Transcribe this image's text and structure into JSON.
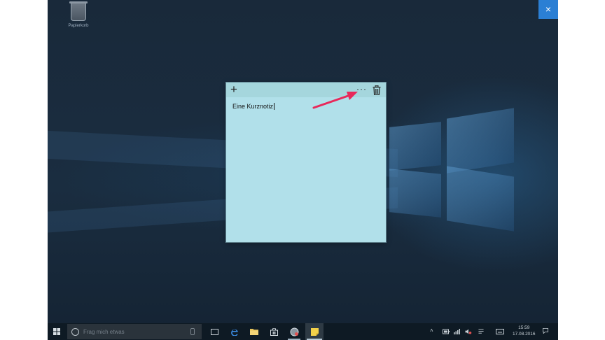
{
  "desktop": {
    "recycle_bin_label": "Papierkorb"
  },
  "overlay": {
    "close_glyph": "×",
    "accent": "#2b7fd4"
  },
  "sticky_note": {
    "add_glyph": "+",
    "menu_glyph": "···",
    "text": "Eine Kurznotiz",
    "background": "#b1e0ea",
    "toolbar_background": "#a5d6dd"
  },
  "annotation": {
    "arrow_color": "#e8285a"
  },
  "taskbar": {
    "search_placeholder": "Frag mich etwas",
    "clock_time": "15:59",
    "clock_date": "17.08.2016"
  }
}
